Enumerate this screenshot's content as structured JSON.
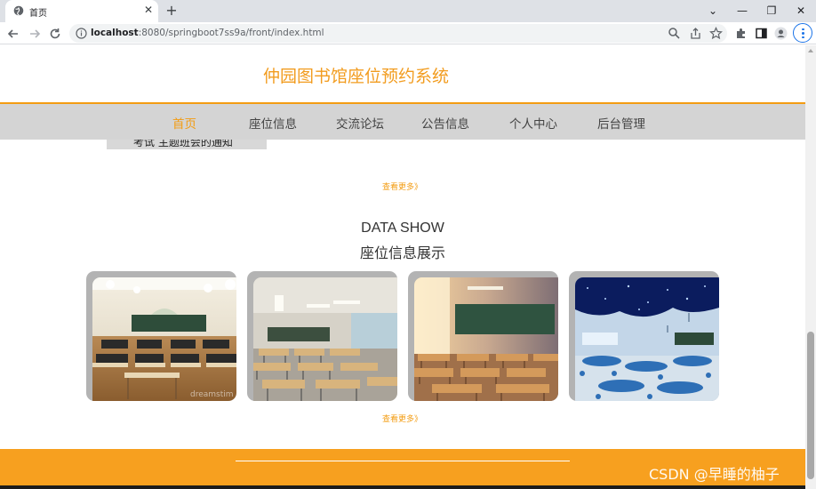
{
  "browser": {
    "tab_title": "首页",
    "tab_close": "✕",
    "new_tab": "+",
    "url_host": "localhost",
    "url_path": ":8080/springboot7ss9a/front/index.html",
    "window_controls": [
      "⌄",
      "—",
      "❐",
      "✕"
    ]
  },
  "site": {
    "title": "仲园图书馆座位预约系统",
    "nav": [
      "首页",
      "座位信息",
      "交流论坛",
      "公告信息",
      "个人中心",
      "后台管理"
    ],
    "active_nav": "首页"
  },
  "notice": {
    "partial_text": "考试 主题班会的通知"
  },
  "more_links": {
    "notice_more": "查看更多》",
    "seat_more": "查看更多》"
  },
  "data_show": {
    "title_en": "DATA SHOW",
    "title_cn": "座位信息展示"
  },
  "seat_cards": [
    {
      "name": "classroom-1",
      "watermark": "dreamstim"
    },
    {
      "name": "classroom-2",
      "watermark": ""
    },
    {
      "name": "classroom-3",
      "watermark": ""
    },
    {
      "name": "classroom-4",
      "watermark": ""
    }
  ],
  "watermark": "CSDN @早睡的柚子",
  "colors": {
    "accent": "#f39c12",
    "nav_bg": "#d4d4d4",
    "footer": "#f7a01f"
  }
}
